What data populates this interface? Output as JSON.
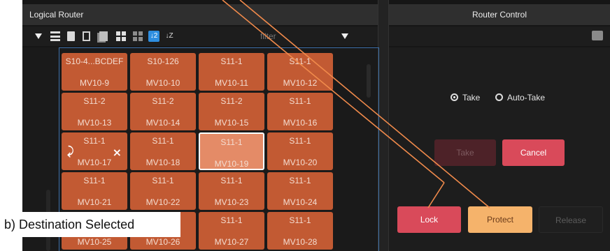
{
  "annotation": {
    "caption": "b) Destination Selected",
    "line_color": "#f08a4b"
  },
  "left_panel": {
    "title": "Logical Router",
    "filter_placeholder": "filter",
    "toolbar_icons": [
      "funnel-icon",
      "list-view-icon",
      "document-icon",
      "document-outline-icon",
      "documents-icon",
      "grid-view-icon",
      "grid-outline-icon",
      "sort-ascending-icon",
      "sort-descending-icon",
      "funnel-icon"
    ],
    "sort_asc_label": "↓2",
    "sort_desc_label": "↓Z"
  },
  "tiles": [
    {
      "src": "S10-4...BCDEF",
      "dst": "MV10-9"
    },
    {
      "src": "S10-126",
      "dst": "MV10-10"
    },
    {
      "src": "S11-1",
      "dst": "MV10-11"
    },
    {
      "src": "S11-1",
      "dst": "MV10-12"
    },
    {
      "src": "S11-2",
      "dst": "MV10-13"
    },
    {
      "src": "S11-2",
      "dst": "MV10-14"
    },
    {
      "src": "S11-2",
      "dst": "MV10-15"
    },
    {
      "src": "S11-1",
      "dst": "MV10-16"
    },
    {
      "src": "S11-1",
      "dst": "MV10-17",
      "icons": true
    },
    {
      "src": "S11-1",
      "dst": "MV10-18"
    },
    {
      "src": "S11-1",
      "dst": "MV10-19",
      "selected": true
    },
    {
      "src": "S11-1",
      "dst": "MV10-20"
    },
    {
      "src": "S11-1",
      "dst": "MV10-21"
    },
    {
      "src": "S11-1",
      "dst": "MV10-22"
    },
    {
      "src": "S11-1",
      "dst": "MV10-23"
    },
    {
      "src": "S11-1",
      "dst": "MV10-24"
    },
    {
      "src": "",
      "dst": "MV10-25"
    },
    {
      "src": "",
      "dst": "MV10-26"
    },
    {
      "src": "S11-1",
      "dst": "MV10-27"
    },
    {
      "src": "S11-1",
      "dst": "MV10-28"
    }
  ],
  "right_panel": {
    "title": "Router Control",
    "radio_take": "Take",
    "radio_auto_take": "Auto-Take",
    "take_button": "Take",
    "cancel_button": "Cancel",
    "lock_button": "Lock",
    "protect_button": "Protect",
    "release_button": "Release"
  },
  "colors": {
    "tile": "#c25a33",
    "tile_selected": "#e48b67",
    "lock": "#d94a5a",
    "protect": "#f5b36b",
    "accent_blue": "#2e8ee0"
  }
}
